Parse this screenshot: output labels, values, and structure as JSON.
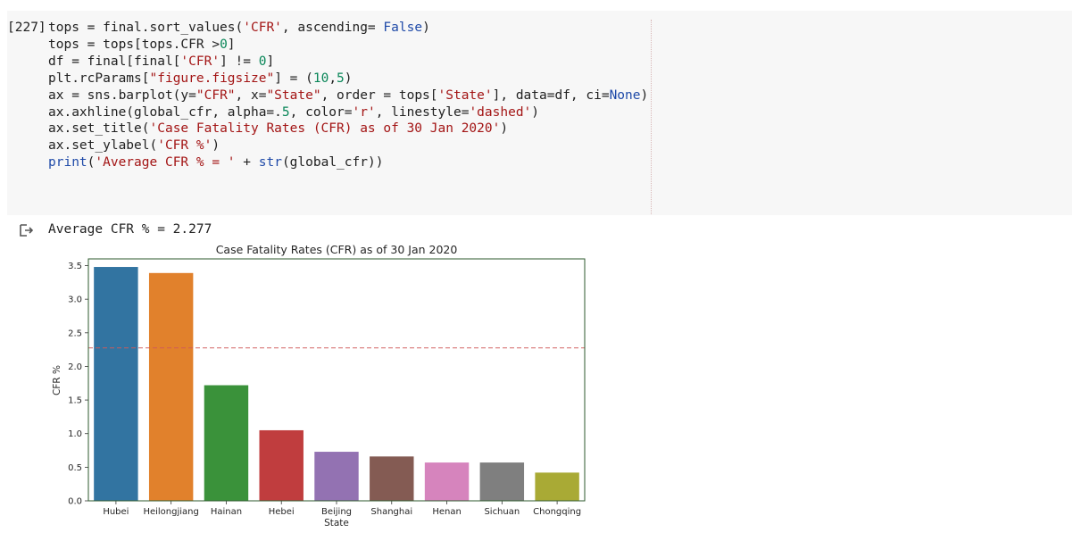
{
  "cell": {
    "execution_count": "[227]",
    "code_lines": [
      [
        {
          "t": "tops = final.sort_values("
        },
        {
          "t": "'CFR'",
          "c": "s"
        },
        {
          "t": ", ascending= "
        },
        {
          "t": "False",
          "c": "k"
        },
        {
          "t": ")"
        }
      ],
      [
        {
          "t": "tops = tops[tops.CFR >"
        },
        {
          "t": "0",
          "c": "n"
        },
        {
          "t": "]"
        }
      ],
      [
        {
          "t": "df = final[final["
        },
        {
          "t": "'CFR'",
          "c": "s"
        },
        {
          "t": "] != "
        },
        {
          "t": "0",
          "c": "n"
        },
        {
          "t": "]"
        }
      ],
      [
        {
          "t": "plt.rcParams["
        },
        {
          "t": "\"figure.figsize\"",
          "c": "s"
        },
        {
          "t": "] = ("
        },
        {
          "t": "10",
          "c": "n"
        },
        {
          "t": ","
        },
        {
          "t": "5",
          "c": "n"
        },
        {
          "t": ")"
        }
      ],
      [
        {
          "t": "ax = sns.barplot(y="
        },
        {
          "t": "\"CFR\"",
          "c": "s"
        },
        {
          "t": ", x="
        },
        {
          "t": "\"State\"",
          "c": "s"
        },
        {
          "t": ", order = tops["
        },
        {
          "t": "'State'",
          "c": "s"
        },
        {
          "t": "], data=df, ci="
        },
        {
          "t": "None",
          "c": "k"
        },
        {
          "t": ")"
        }
      ],
      [
        {
          "t": "ax.axhline(global_cfr, alpha=."
        },
        {
          "t": "5",
          "c": "n"
        },
        {
          "t": ", color="
        },
        {
          "t": "'r'",
          "c": "s"
        },
        {
          "t": ", linestyle="
        },
        {
          "t": "'dashed'",
          "c": "s"
        },
        {
          "t": ")"
        }
      ],
      [
        {
          "t": "ax.set_title("
        },
        {
          "t": "'Case Fatality Rates (CFR) as of 30 Jan 2020'",
          "c": "s"
        },
        {
          "t": ")"
        }
      ],
      [
        {
          "t": "ax.set_ylabel("
        },
        {
          "t": "'CFR %'",
          "c": "s"
        },
        {
          "t": ")"
        }
      ],
      [
        {
          "t": "print",
          "c": "k"
        },
        {
          "t": "("
        },
        {
          "t": "'Average CFR % = '",
          "c": "s"
        },
        {
          "t": " + "
        },
        {
          "t": "str",
          "c": "k"
        },
        {
          "t": "(global_cfr))"
        }
      ]
    ]
  },
  "output": {
    "icon": "output-redirect-icon",
    "text": "Average CFR % = 2.277"
  },
  "chart_data": {
    "type": "bar",
    "title": "Case Fatality Rates (CFR) as of 30 Jan 2020",
    "xlabel": "State",
    "ylabel": "CFR %",
    "categories": [
      "Hubei",
      "Heilongjiang",
      "Hainan",
      "Hebei",
      "Beijing",
      "Shanghai",
      "Henan",
      "Sichuan",
      "Chongqing"
    ],
    "values": [
      3.48,
      3.39,
      1.72,
      1.05,
      0.73,
      0.66,
      0.57,
      0.57,
      0.42
    ],
    "colors": [
      "#3274a1",
      "#e1812c",
      "#3a923a",
      "#c03d3e",
      "#9372b2",
      "#845b53",
      "#d684bd",
      "#7f7f7f",
      "#a9aa35"
    ],
    "ylim": [
      0,
      3.6
    ],
    "yticks": [
      0.0,
      0.5,
      1.0,
      1.5,
      2.0,
      2.5,
      3.0,
      3.5
    ],
    "ytick_labels": [
      "0.0",
      "0.5",
      "1.0",
      "1.5",
      "2.0",
      "2.5",
      "3.0",
      "3.5"
    ],
    "reference_line": {
      "value": 2.277,
      "color": "#d05a5a",
      "style": "dashed"
    },
    "grid": false,
    "legend": "none"
  }
}
